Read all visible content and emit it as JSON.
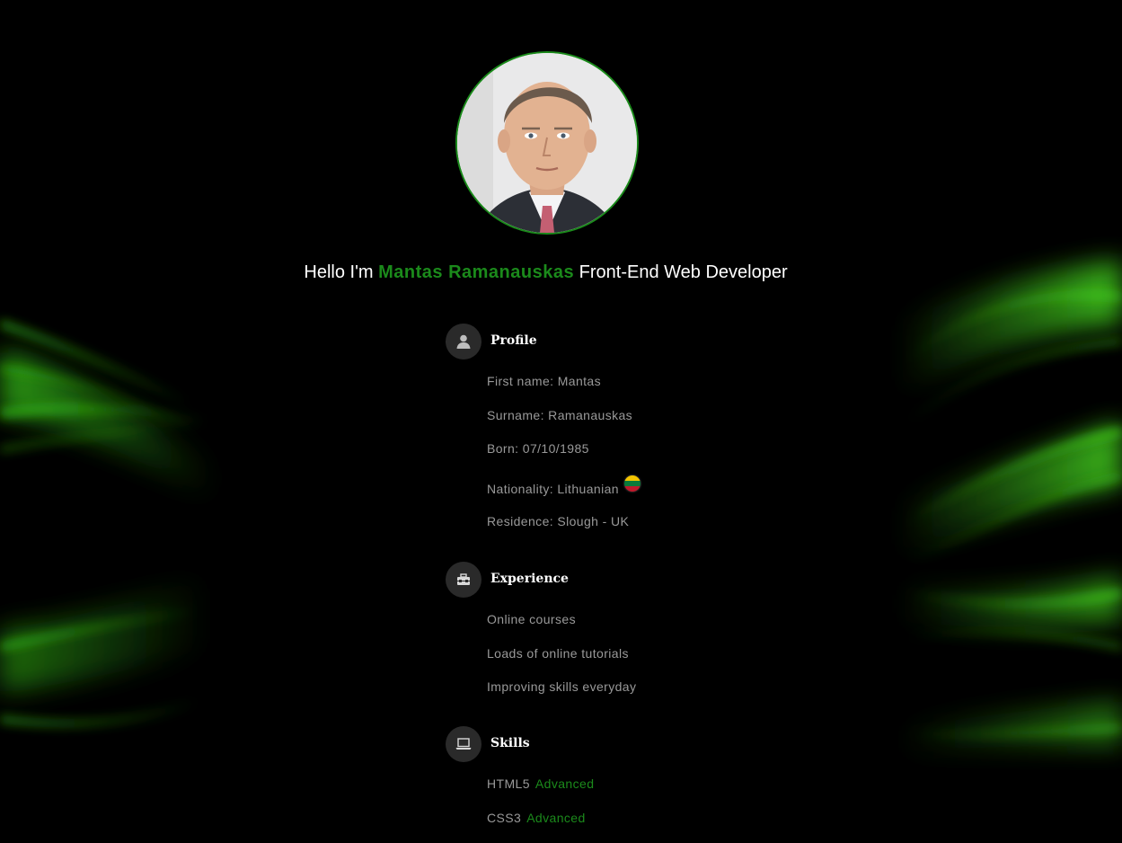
{
  "header": {
    "greeting": "Hello I'm",
    "name": "Mantas Ramanauskas",
    "role": "Front-End Web Developer"
  },
  "profile": {
    "title": "Profile",
    "icon": "person-icon",
    "items": [
      "First name: Mantas",
      "Surname: Ramanauskas",
      "Born: 07/10/1985",
      "Nationality: Lithuanian",
      "Residence: Slough - UK"
    ],
    "nationality_flag": "lithuania-flag-icon"
  },
  "experience": {
    "title": "Experience",
    "icon": "briefcase-icon",
    "items": [
      "Online courses",
      "Loads of online tutorials",
      "Improving skills everyday"
    ]
  },
  "skills": {
    "title": "Skills",
    "icon": "laptop-icon",
    "items": [
      {
        "name": "HTML5",
        "level": "Advanced"
      },
      {
        "name": "CSS3",
        "level": "Advanced"
      }
    ]
  },
  "colors": {
    "accent": "#1b8a1b",
    "text_muted": "#999999",
    "icon_bg": "#2a2a2a",
    "background": "#000000"
  }
}
